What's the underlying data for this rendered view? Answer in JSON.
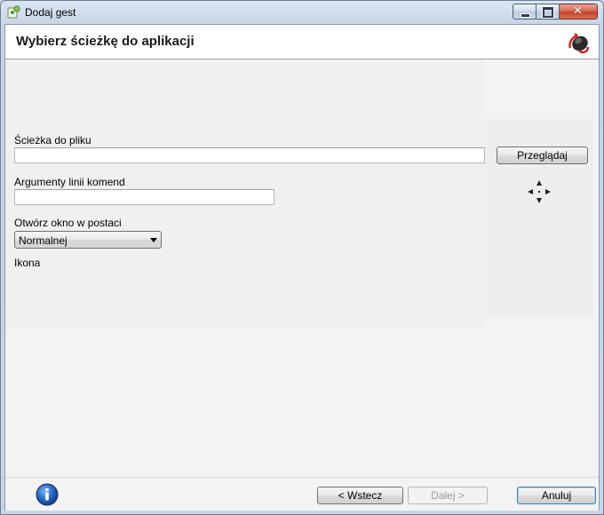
{
  "window": {
    "title": "Dodaj gest",
    "minimize_label": "",
    "close_glyph": "✕"
  },
  "header": {
    "title": "Wybierz ścieżkę do aplikacji",
    "icon": "mouse-gesture-logo-icon"
  },
  "form": {
    "path_label": "Ścieżka do pliku",
    "path_value": "",
    "browse_label": "Przeglądaj",
    "args_label": "Argumenty linii komend",
    "args_value": "",
    "window_mode_label": "Otwórz okno w postaci",
    "window_mode_selected": "Normalnej",
    "icon_label": "Ikona",
    "icon_picker": "crosshair-pick-icon"
  },
  "footer": {
    "info_icon": "info-icon",
    "back_label": "< Wstecz",
    "next_label": "Dalej >",
    "cancel_label": "Anuluj"
  },
  "colors": {
    "accent": "#3c7fb1",
    "close_button": "#c4402a",
    "info_blue": "#1f5fb8"
  }
}
